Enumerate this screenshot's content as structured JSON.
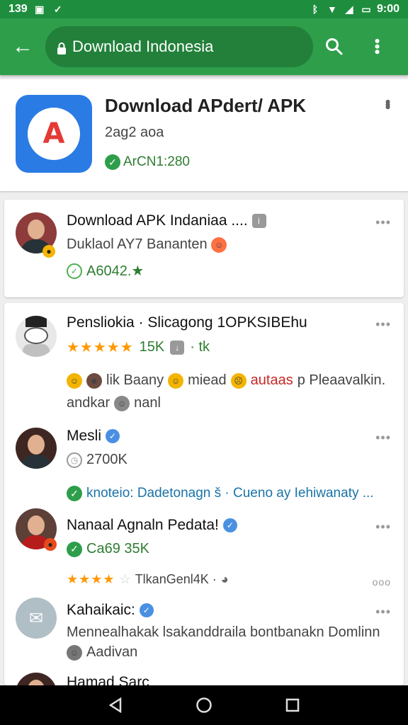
{
  "status_bar": {
    "time_left": "139",
    "time_right": "9:00"
  },
  "toolbar": {
    "url": "Download Indonesia"
  },
  "hero": {
    "title": "Download APdert/ APK",
    "subtitle": "2ag2 aoa",
    "version": "ArCN1:280"
  },
  "card1": {
    "title": "Download APK Indaniaa ....",
    "subtitle": "Duklaol AY7 Bananten",
    "meta": "A6042.★"
  },
  "feed": [
    {
      "title": "Pensliokia · Slicagong 1OPKSIBEhu",
      "rating_stars": "★★★★★",
      "rating_count": "15K",
      "rating_suffix": "· tk",
      "body_line1_a": "lik Baany",
      "body_line1_b": "miead",
      "body_line1_c": "autaas",
      "body_line1_d": "p Pleaavalkin.",
      "body_line2_a": "andkar",
      "body_line2_b": "nanl"
    },
    {
      "title": "Mesli",
      "count": "2700K",
      "link": "knoteio: Dadetonagn š · Cueno ay Iehiwanaty ..."
    },
    {
      "title": "Nanaal Agnaln Pedata!",
      "count": "Ca69 35K",
      "rating_stars": "★★★★",
      "rating_text": "TlkanGenl4K ·"
    },
    {
      "title": "Kahaikaic:",
      "body": "Mennealhakak lsakanddraila bontbanakn Domlinn",
      "footer": "Aadivan"
    },
    {
      "title": "Hamad Sarc"
    }
  ]
}
